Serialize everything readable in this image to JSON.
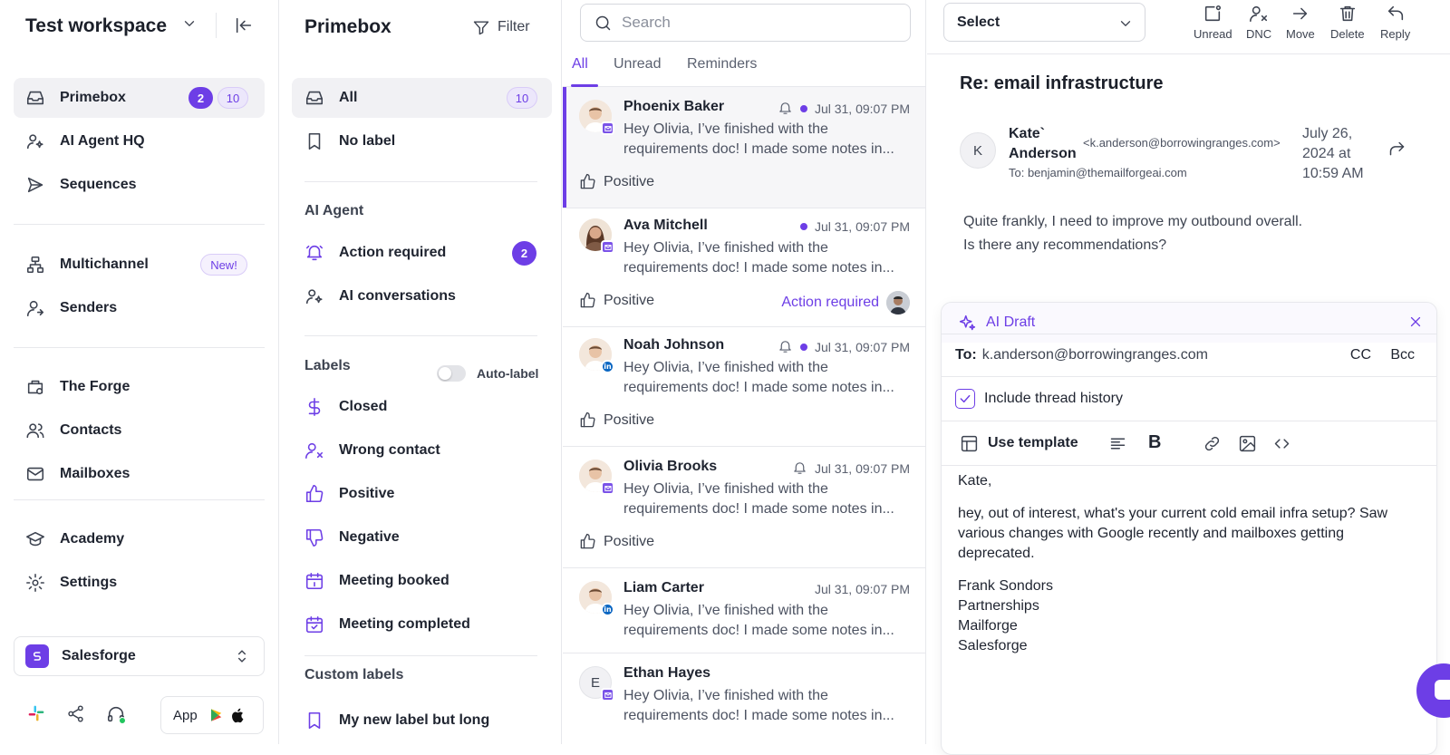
{
  "workspace": {
    "name": "Test workspace"
  },
  "sidebar": {
    "items": [
      {
        "label": "Primebox",
        "badge_unread": "2",
        "badge_total": "10"
      },
      {
        "label": "AI Agent HQ"
      },
      {
        "label": "Sequences"
      },
      {
        "label": "Multichannel",
        "badge": "New!"
      },
      {
        "label": "Senders"
      },
      {
        "label": "The Forge"
      },
      {
        "label": "Contacts"
      },
      {
        "label": "Mailboxes"
      },
      {
        "label": "Academy"
      },
      {
        "label": "Settings"
      }
    ],
    "org": "Salesforge",
    "app_label": "App"
  },
  "primebox": {
    "title": "Primebox",
    "filter_label": "Filter",
    "all_label": "All",
    "all_count": "10",
    "no_label": "No label",
    "ai_agent_title": "AI Agent",
    "action_required": "Action required",
    "action_required_count": "2",
    "ai_conversations": "AI conversations",
    "labels_title": "Labels",
    "auto_label": "Auto-label",
    "labels": [
      "Closed",
      "Wrong contact",
      "Positive",
      "Negative",
      "Meeting booked",
      "Meeting completed"
    ],
    "custom_title": "Custom labels",
    "custom_labels": [
      "My new label but long"
    ]
  },
  "threads": {
    "search_placeholder": "Search",
    "tabs": [
      "All",
      "Unread",
      "Reminders"
    ],
    "items": [
      {
        "name": "Phoenix Baker",
        "time": "Jul 31, 09:07 PM",
        "preview": "Hey Olivia, I’ve finished with the requirements doc! I made some notes in...",
        "label": "Positive"
      },
      {
        "name": "Ava Mitchell",
        "time": "Jul 31, 09:07 PM",
        "preview": "Hey Olivia, I’ve finished with the requirements doc! I made some notes in...",
        "label": "Positive",
        "action": "Action required"
      },
      {
        "name": "Noah Johnson",
        "time": "Jul 31, 09:07 PM",
        "preview": "Hey Olivia, I’ve finished with the requirements doc! I made some notes in...",
        "label": "Positive"
      },
      {
        "name": "Olivia Brooks",
        "time": "Jul 31, 09:07 PM",
        "preview": "Hey Olivia, I’ve finished with the requirements doc! I made some notes in...",
        "label": "Positive"
      },
      {
        "name": "Liam Carter",
        "time": "Jul 31, 09:07 PM",
        "preview": "Hey Olivia, I’ve finished with the requirements doc! I made some notes in..."
      },
      {
        "name": "Ethan Hayes",
        "initial": "E",
        "preview": "Hey Olivia, I’ve finished with the requirements doc! I made some notes in..."
      }
    ]
  },
  "detail": {
    "select_label": "Select",
    "toolbar": [
      "Unread",
      "DNC",
      "Move",
      "Delete",
      "Reply"
    ],
    "subject": "Re: email infrastructure",
    "sender_initial": "K",
    "sender_name": "Kate` Anderson",
    "sender_email": "<k.anderson@borrowingranges.com>",
    "to": "To: benjamin@themailforgeai.com",
    "date": "July 26, 2024 at 10:59 AM",
    "body": "Quite frankly, I need to improve my outbound overall.\nIs there any recommendations?",
    "draft": {
      "title": "AI Draft",
      "to_label": "To:",
      "to_value": "k.anderson@borrowingranges.com",
      "cc": "CC",
      "bcc": "Bcc",
      "include_history": "Include thread history",
      "use_template": "Use template",
      "greeting": "Kate,",
      "paragraph": "hey, out of interest, what's your current cold email infra setup? Saw various changes with Google recently and mailboxes getting deprecated.",
      "signature": [
        "Frank Sondors",
        "Partnerships",
        "Mailforge",
        "Salesforge"
      ]
    }
  },
  "colors": {
    "accent": "#6d3ee6",
    "linkedin": "#0a66c2"
  }
}
